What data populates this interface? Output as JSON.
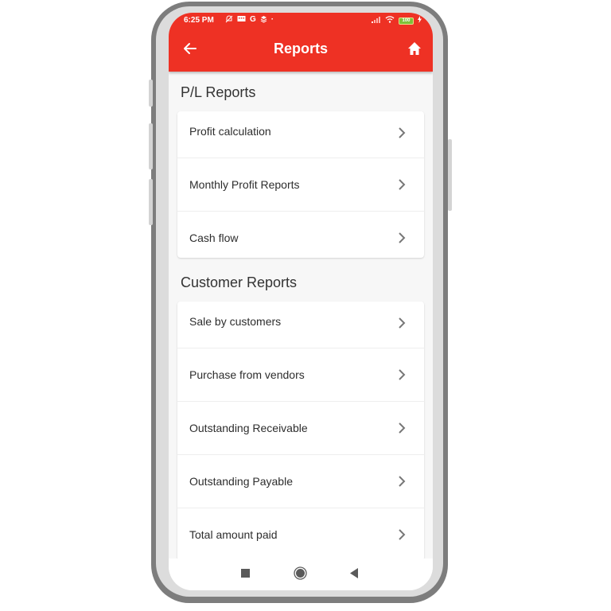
{
  "status_bar": {
    "time": "6:25 PM",
    "left_icons": [
      "bell-off-icon",
      "message-icon",
      "google-icon",
      "layers-icon",
      "dot-icon"
    ],
    "right_icons": [
      "signal-icon",
      "wifi-icon",
      "battery-icon",
      "charging-icon"
    ],
    "battery_level": "100"
  },
  "app_bar": {
    "title": "Reports",
    "back_icon": "arrow-left-icon",
    "home_icon": "home-icon",
    "color": "#ee3124"
  },
  "sections": [
    {
      "title": "P/L Reports",
      "items": [
        {
          "label": "Profit calculation"
        },
        {
          "label": "Monthly Profit Reports"
        },
        {
          "label": "Cash flow"
        }
      ]
    },
    {
      "title": "Customer Reports",
      "items": [
        {
          "label": "Sale by customers"
        },
        {
          "label": "Purchase from vendors"
        },
        {
          "label": "Outstanding Receivable"
        },
        {
          "label": "Outstanding Payable"
        },
        {
          "label": "Total amount paid"
        }
      ]
    }
  ],
  "nav_bar": {
    "buttons": [
      "recents-icon",
      "home-circle-icon",
      "back-triangle-icon"
    ]
  }
}
